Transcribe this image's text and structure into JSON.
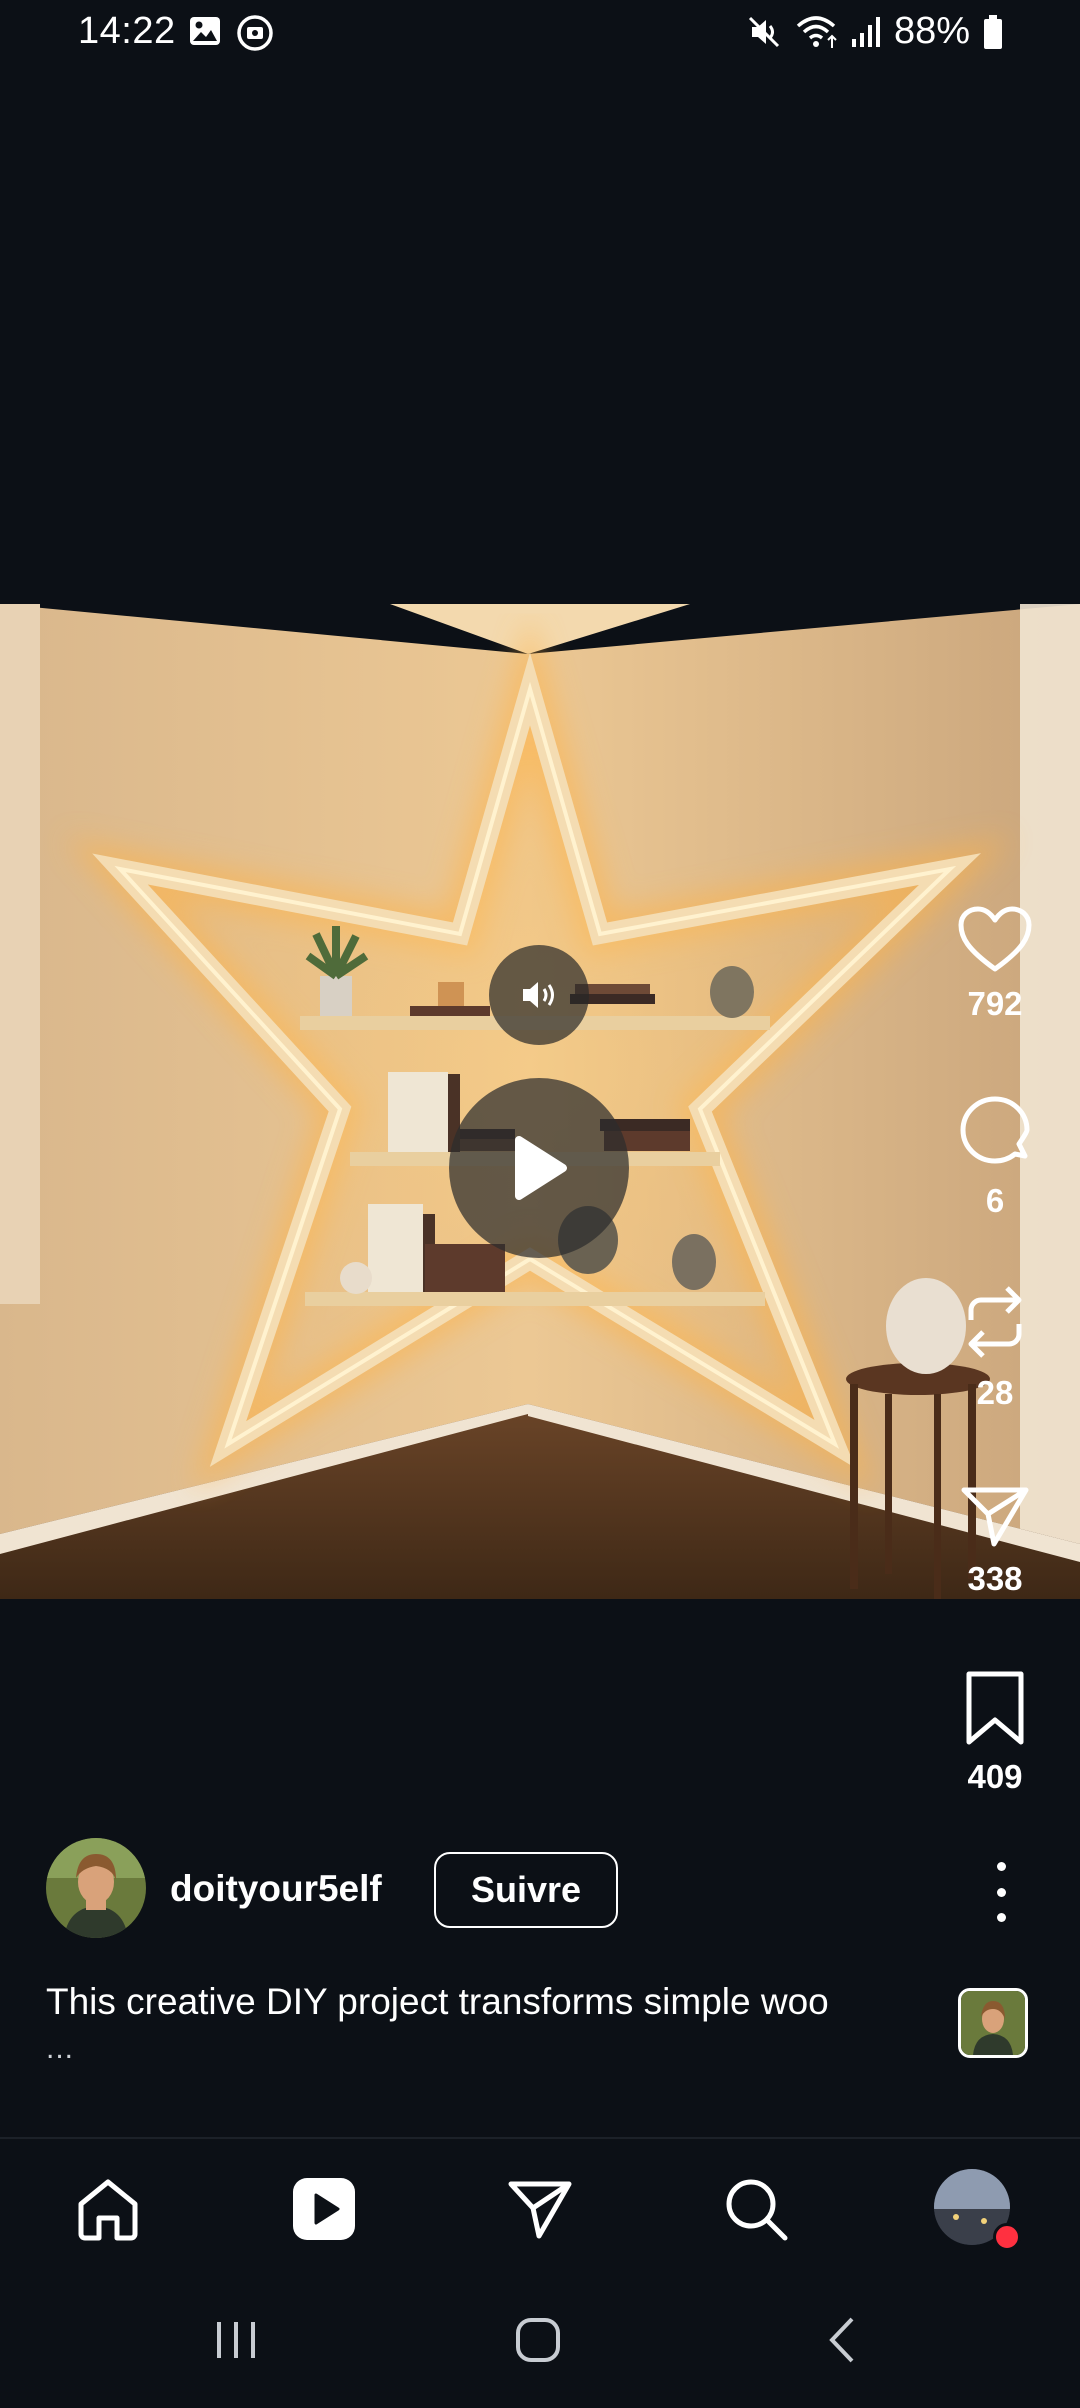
{
  "status_bar": {
    "time": "14:22",
    "battery": "88%",
    "left_icons": [
      "gallery-icon",
      "screen-record-icon"
    ],
    "right_icons": [
      "mute-icon",
      "wifi-icon",
      "signal-icon",
      "battery-icon"
    ]
  },
  "media": {
    "overlay_icons": [
      "sound-icon",
      "play-icon"
    ]
  },
  "actions": {
    "like_count": "792",
    "comment_count": "6",
    "repost_count": "28",
    "share_count": "338",
    "save_count": "409"
  },
  "author": {
    "username": "doityour5elf",
    "follow_label": "Suivre"
  },
  "caption": {
    "text": "This creative DIY project transforms simple woo",
    "more": "..."
  },
  "bottom_nav": {
    "items": [
      "home-icon",
      "reels-icon",
      "messages-icon",
      "search-icon",
      "profile-avatar"
    ]
  },
  "system_nav": {
    "items": [
      "recents-icon",
      "home-circle-icon",
      "back-icon"
    ]
  },
  "colors": {
    "background": "#0c1016",
    "notification_dot": "#ff3040",
    "glow": "#ffb347"
  }
}
